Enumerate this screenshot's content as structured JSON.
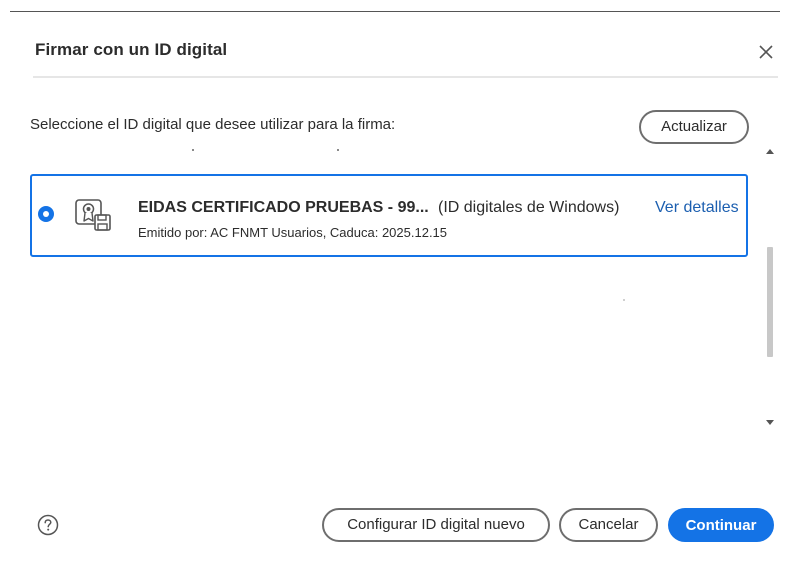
{
  "dialog": {
    "title": "Firmar con un ID digital",
    "close_icon": "close-icon"
  },
  "instruction": "Seleccione el ID digital que desee utilizar para la firma:",
  "refresh_label": "Actualizar",
  "selected_id": {
    "name": "EIDAS CERTIFICADO PRUEBAS - 99...",
    "source": "(ID digitales de Windows)",
    "details_label": "Ver detalles",
    "issuer_line": "Emitido por: AC FNMT Usuarios, Caduca: 2025.12.15",
    "icon": "certificate-icon",
    "selected": true
  },
  "footer": {
    "help_icon": "help-icon",
    "new_id_label": "Configurar ID digital nuevo",
    "cancel_label": "Cancelar",
    "continue_label": "Continuar"
  },
  "colors": {
    "accent": "#1473e6",
    "link": "#1c5fb0",
    "button_border": "#6e6e6e"
  }
}
